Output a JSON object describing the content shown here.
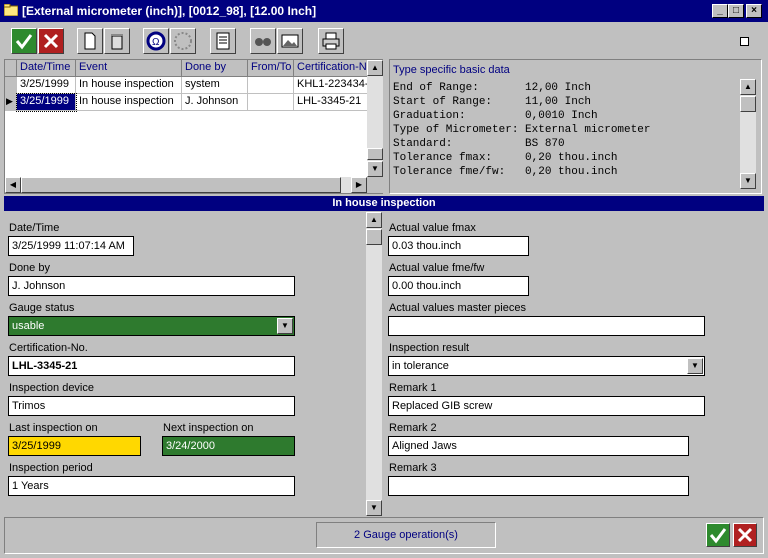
{
  "window": {
    "title": "[External micrometer (inch)], [0012_98], [12.00 Inch]",
    "min_glyph": "_",
    "max_glyph": "□",
    "close_glyph": "×"
  },
  "colors": {
    "title_bg": "#000080",
    "status_green": "#2e7a2e",
    "last_inspection_yellow": "#ffd800",
    "next_inspection_green": "#2e7a2e"
  },
  "toolbar": {
    "icons": [
      "ok-icon",
      "cancel-icon",
      "new-document-icon",
      "delete-icon",
      "gauge-icon",
      "dotted-circle-icon",
      "report-icon",
      "binoculars-icon",
      "image-icon",
      "printer-icon"
    ]
  },
  "grid": {
    "headers": [
      "Date/Time",
      "Event",
      "Done by",
      "From/To",
      "Certification-No"
    ],
    "rows": [
      [
        "3/25/1999",
        "In house inspection",
        "system",
        "",
        "KHL1-223434-"
      ],
      [
        "3/25/1999",
        "In house inspection",
        "J. Johnson",
        "",
        "LHL-3345-21"
      ]
    ]
  },
  "spec": {
    "title": "Type specific basic data",
    "rows": [
      "End of Range:       12,00 Inch",
      "Start of Range:     11,00 Inch",
      "Graduation:         0,0010 Inch",
      "Type of Micrometer: External micrometer",
      "Standard:           BS 870",
      "Tolerance fmax:     0,20 thou.inch",
      "Tolerance fme/fw:   0,20 thou.inch"
    ]
  },
  "section_title": "In house inspection",
  "form": {
    "date_time_label": "Date/Time",
    "date_time_value": "3/25/1999 11:07:14 AM",
    "done_by_label": "Done by",
    "done_by_value": "J. Johnson",
    "gauge_status_label": "Gauge status",
    "gauge_status_value": "usable",
    "certification_label": "Certification-No.",
    "certification_value": "LHL-3345-21",
    "inspection_device_label": "Inspection device",
    "inspection_device_value": "Trimos",
    "last_inspection_label": "Last inspection on",
    "last_inspection_value": "3/25/1999",
    "next_inspection_label": "Next inspection on",
    "next_inspection_value": "3/24/2000",
    "inspection_period_label": "Inspection period",
    "inspection_period_value": "1 Years",
    "fmax_label": "Actual value fmax",
    "fmax_value": "0.03 thou.inch",
    "fmefw_label": "Actual value fme/fw",
    "fmefw_value": "0.00 thou.inch",
    "master_label": "Actual values master pieces",
    "master_value": "",
    "result_label": "Inspection result",
    "result_value": "in tolerance",
    "remark1_label": "Remark 1",
    "remark1_value": "Replaced GIB screw",
    "remark2_label": "Remark 2",
    "remark2_value": "Aligned Jaws",
    "remark3_label": "Remark 3",
    "remark3_value": ""
  },
  "status": {
    "text": "2 Gauge operation(s)"
  }
}
